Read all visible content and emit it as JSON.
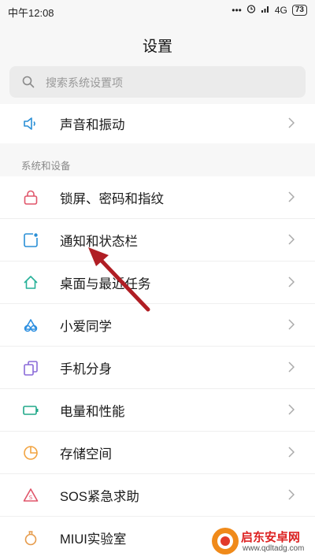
{
  "status_bar": {
    "time": "中午12:08",
    "dots": "•••",
    "network": "4G",
    "battery": "73"
  },
  "header": {
    "title": "设置"
  },
  "search": {
    "placeholder": "搜索系统设置项"
  },
  "top_item": {
    "label": "声音和振动",
    "icon": "speaker-icon"
  },
  "section": {
    "label": "系统和设备",
    "items": [
      {
        "label": "锁屏、密码和指纹",
        "icon": "lock-icon",
        "color": "#e0556a"
      },
      {
        "label": "通知和状态栏",
        "icon": "notification-icon",
        "color": "#2a8fd6"
      },
      {
        "label": "桌面与最近任务",
        "icon": "home-icon",
        "color": "#27b199"
      },
      {
        "label": "小爱同学",
        "icon": "xiaoai-icon",
        "color": "#2d8fe0"
      },
      {
        "label": "手机分身",
        "icon": "dual-icon",
        "color": "#8a6ad8"
      },
      {
        "label": "电量和性能",
        "icon": "battery-icon",
        "color": "#20a889"
      },
      {
        "label": "存储空间",
        "icon": "storage-icon",
        "color": "#f2a340"
      },
      {
        "label": "SOS紧急求助",
        "icon": "sos-icon",
        "color": "#e0556a"
      },
      {
        "label": "MIUI实验室",
        "icon": "lab-icon",
        "color": "#e69b4b"
      }
    ]
  },
  "watermark": {
    "title": "启东安卓网",
    "url": "www.qdltadg.com"
  }
}
